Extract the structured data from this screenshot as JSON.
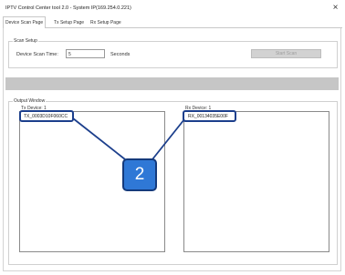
{
  "window": {
    "title": "IPTV Control Center tool 2.0 - System IP(169.254.0.221)",
    "close_glyph": "×"
  },
  "tabs": [
    {
      "label": "Device Scan Page",
      "active": true
    },
    {
      "label": "Tx Setup Page",
      "active": false
    },
    {
      "label": "Rx Setup Page",
      "active": false
    }
  ],
  "scan_setup": {
    "group_label": "Scan Setup",
    "time_label": "Device Scan Time:",
    "time_value": "5",
    "time_unit": "Seconds",
    "start_button": "Start Scan"
  },
  "output": {
    "group_label": "Output Window",
    "tx_label": "Tx Device: 1",
    "tx_devices": [
      "TX_0003D10F060CC"
    ],
    "rx_label": "Rx Device: 1",
    "rx_devices": [
      "RX_00134035E00F"
    ]
  },
  "callout": {
    "number": "2",
    "fill_color": "#2f78d6",
    "border_color": "#143a7c"
  }
}
